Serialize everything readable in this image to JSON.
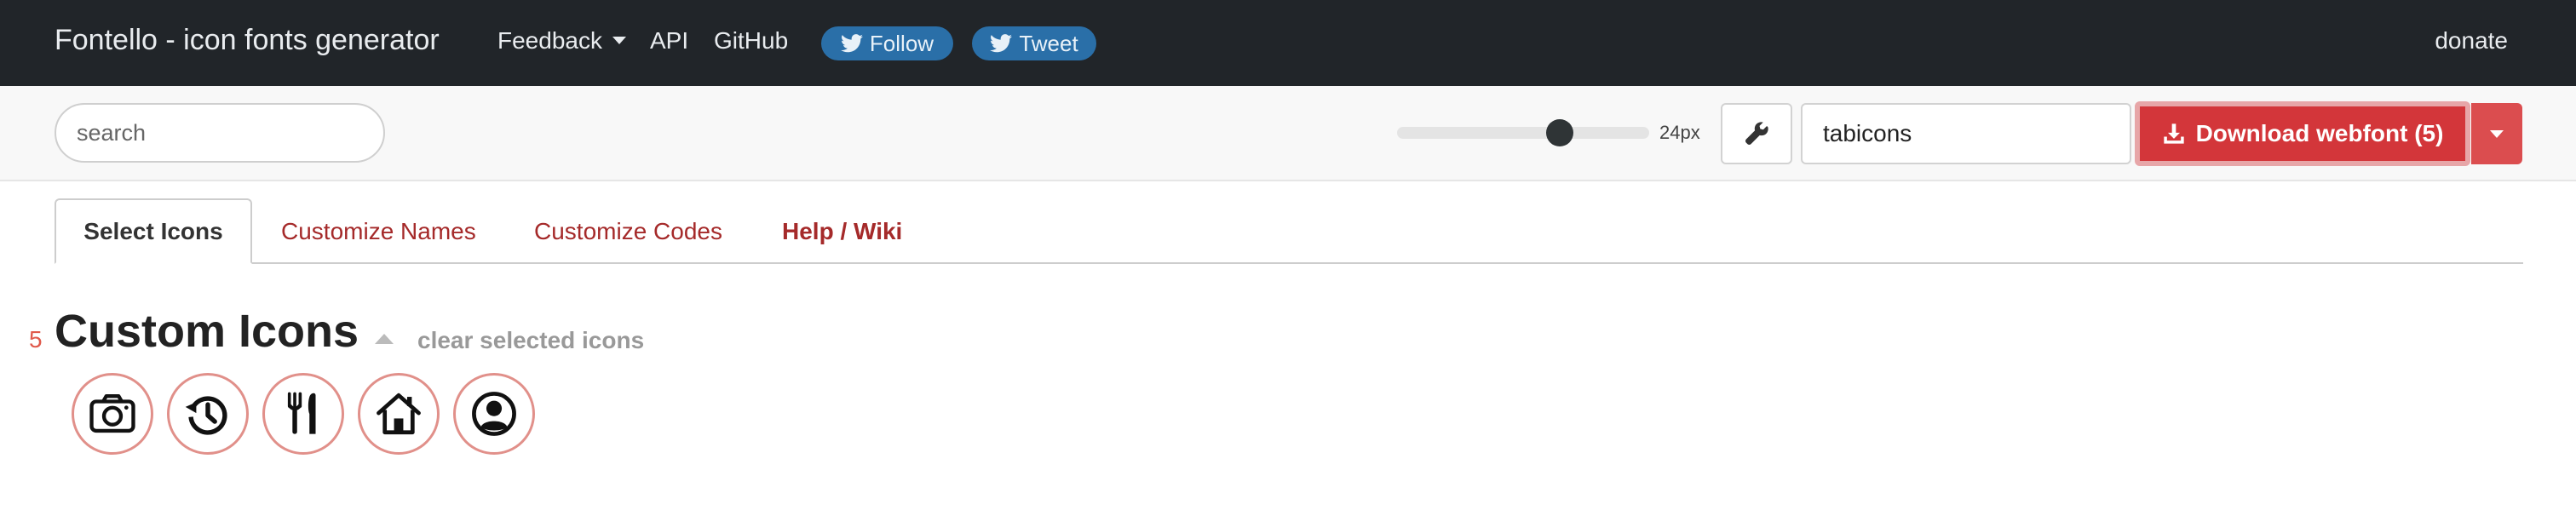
{
  "navbar": {
    "brand": "Fontello - icon fonts generator",
    "items": [
      {
        "label": "Feedback",
        "has_dropdown": true
      },
      {
        "label": "API"
      },
      {
        "label": "GitHub"
      }
    ],
    "follow_label": "Follow",
    "tweet_label": "Tweet",
    "donate_label": "donate",
    "background": "#212529",
    "social_color": "#2a6fa8"
  },
  "toolbar": {
    "search_placeholder": "search",
    "size_label": "24px",
    "font_name": "tabicons",
    "download_label": "Download webfont (5)",
    "wrench_icon": "wrench-icon",
    "download_icon": "download-icon",
    "accent": "#d3363a"
  },
  "tabs": [
    {
      "label": "Select Icons",
      "active": true
    },
    {
      "label": "Customize Names"
    },
    {
      "label": "Customize Codes"
    },
    {
      "label": "Help / Wiki"
    }
  ],
  "section": {
    "count": "5",
    "title": "Custom Icons",
    "clear_label": "clear selected icons",
    "icons": [
      {
        "name": "camera-icon"
      },
      {
        "name": "history-icon"
      },
      {
        "name": "fork-knife-icon"
      },
      {
        "name": "home-icon"
      },
      {
        "name": "user-circle-icon"
      }
    ]
  }
}
